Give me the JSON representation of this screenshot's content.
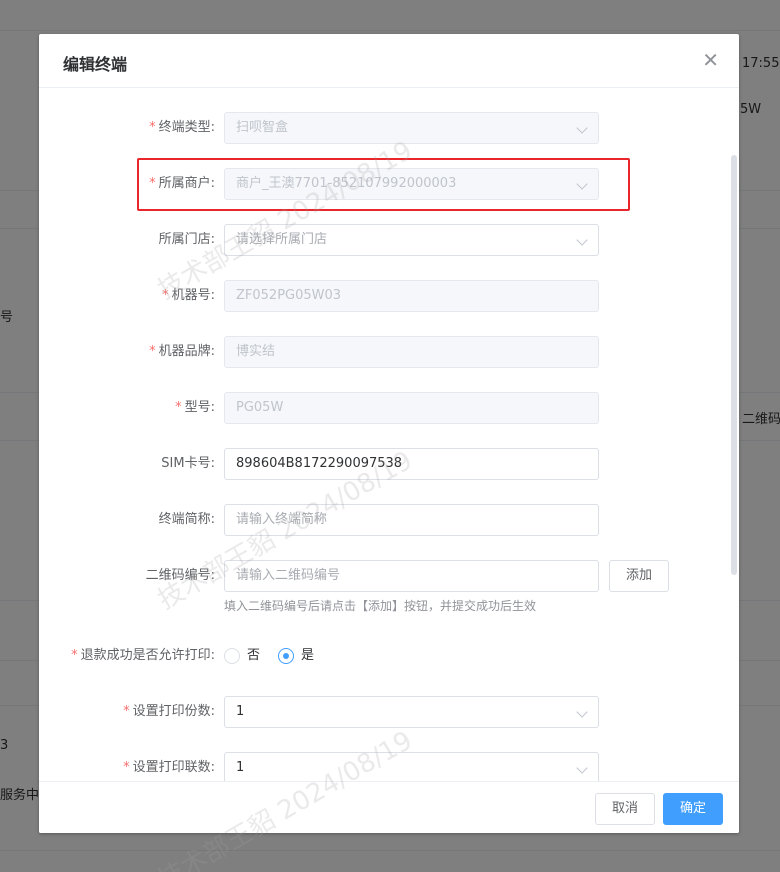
{
  "background": {
    "texts": [
      "17:55:",
      "5W",
      "号",
      "二维码",
      "3",
      "服务中"
    ]
  },
  "watermark": "技术部王貂 2024/08/19",
  "dialog": {
    "title": "编辑终端",
    "fields": {
      "terminal_type": {
        "label": "终端类型",
        "required": true,
        "value": "扫呗智盒",
        "disabled": true
      },
      "merchant": {
        "label": "所属商户",
        "required": true,
        "value": "商户_王澳7701-852107992000003",
        "disabled": true
      },
      "store": {
        "label": "所属门店",
        "required": false,
        "placeholder": "请选择所属门店"
      },
      "machine_no": {
        "label": "机器号",
        "required": true,
        "value": "ZF052PG05W03",
        "disabled": true
      },
      "brand": {
        "label": "机器品牌",
        "required": true,
        "value": "博实结",
        "disabled": true
      },
      "model": {
        "label": "型号",
        "required": true,
        "value": "PG05W",
        "disabled": true
      },
      "sim": {
        "label": "SIM卡号",
        "required": false,
        "value": "898604B8172290097538"
      },
      "short_name": {
        "label": "终端简称",
        "required": false,
        "placeholder": "请输入终端简称"
      },
      "qrcode": {
        "label": "二维码编号",
        "required": false,
        "placeholder": "请输入二维码编号",
        "add_button": "添加",
        "hint": "填入二维码编号后请点击【添加】按钮，并提交成功后生效"
      },
      "refund_print": {
        "label": "退款成功是否允许打印",
        "required": true,
        "options": [
          "否",
          "是"
        ],
        "selected": "是"
      },
      "print_copies": {
        "label": "设置打印份数",
        "required": true,
        "value": "1"
      },
      "print_parts": {
        "label": "设置打印联数",
        "required": true,
        "value": "1"
      }
    },
    "cancel_label": "取消",
    "ok_label": "确定"
  },
  "colors": {
    "primary": "#409eff",
    "required": "#f56c6c",
    "highlight": "#e8262b"
  }
}
